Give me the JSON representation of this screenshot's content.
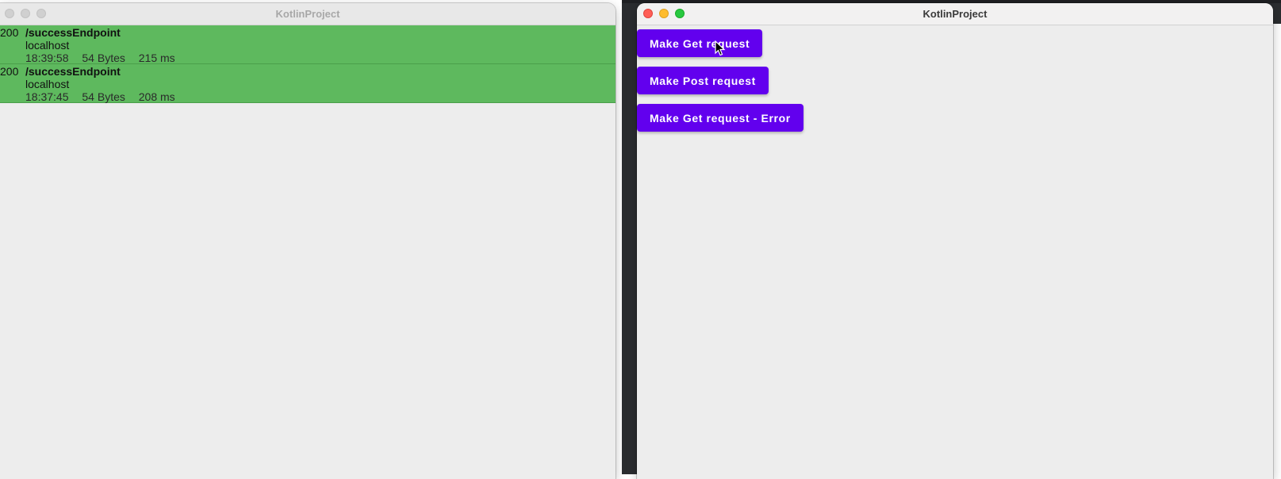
{
  "left_window": {
    "title": "KotlinProject",
    "requests": [
      {
        "status": "200",
        "path": "/successEndpoint",
        "host": "localhost",
        "time": "18:39:58",
        "size": "54 Bytes",
        "duration": "215 ms"
      },
      {
        "status": "200",
        "path": "/successEndpoint",
        "host": "localhost",
        "time": "18:37:45",
        "size": "54 Bytes",
        "duration": "208 ms"
      }
    ]
  },
  "right_window": {
    "title": "KotlinProject",
    "buttons": {
      "get": "Make Get request",
      "post": "Make Post request",
      "get_error": "Make Get request - Error"
    }
  },
  "colors": {
    "success_row": "#5eb95e",
    "button": "#6200ee"
  }
}
